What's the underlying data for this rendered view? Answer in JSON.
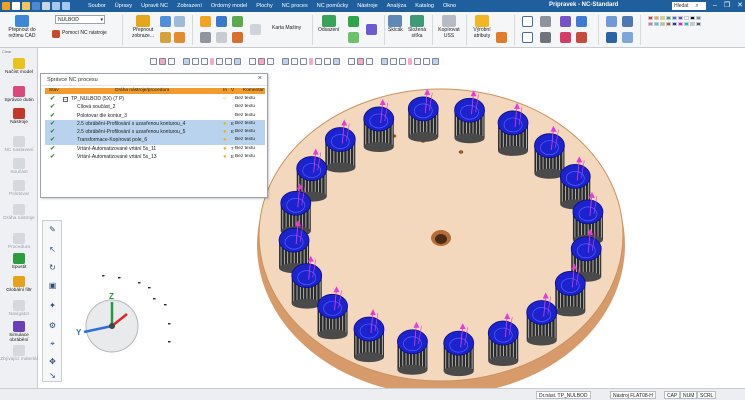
{
  "app": {
    "title": "Pripravek - NC-Standard",
    "menu": [
      "Soubor",
      "Úpravy",
      "Upravit NC",
      "Zobrazení",
      "Ordorný model",
      "Plochy",
      "NC proces",
      "NC pomůcky",
      "Nástroje",
      "Analýza",
      "Katalog",
      "Okno"
    ],
    "search_text": "Hledat"
  },
  "ribbon": {
    "combo_value": "NULBOD",
    "buttons": {
      "prepnout_cad": "Přepnout do režimu CAD",
      "pomoci_nc": "Pomocí NC nástroje",
      "prepnout_zobraz": "Přepnout zobraze...",
      "karta_masiny": "Karta Mašiny",
      "odsazeni": "Odsazení",
      "skicak": "Skicák",
      "slozena_sitka": "Složená síťka",
      "kopirovat_uss": "Kopírovat USS",
      "vyrobni_atributy": "Výrobní atributy"
    },
    "accent_colors": [
      "#d83b3b",
      "#2c7bd6",
      "#3da84b",
      "#f2b01e",
      "#8b3fd1",
      "#e06a1f"
    ]
  },
  "left_panel": {
    "label": "Clear",
    "items": [
      {
        "label": "Načíst model",
        "enabled": true,
        "color": "#e8c31e"
      },
      {
        "label": "Správce dutin",
        "enabled": true,
        "color": "#d94a7a"
      },
      {
        "label": "Nástroje",
        "enabled": true,
        "color": "#c0392b"
      },
      {
        "label": "NC nastavení",
        "enabled": false,
        "color": "#cccccc"
      },
      {
        "label": "Součást",
        "enabled": false,
        "color": "#cccccc"
      },
      {
        "label": "Polotovar",
        "enabled": false,
        "color": "#cccccc"
      },
      {
        "label": "Dráha nástroje",
        "enabled": false,
        "color": "#cccccc"
      },
      {
        "label": "Procedura",
        "enabled": false,
        "color": "#cccccc"
      },
      {
        "label": "Spustit",
        "enabled": true,
        "color": "#2c9c3c"
      },
      {
        "label": "Globální filtr",
        "enabled": true,
        "color": "#e6a21b"
      },
      {
        "label": "Navigátor",
        "enabled": false,
        "color": "#cccccc"
      },
      {
        "label": "Simulace obrábění",
        "enabled": true,
        "color": "#6a3fb8"
      },
      {
        "label": "Zbývající materiál",
        "enabled": false,
        "color": "#cccccc"
      }
    ]
  },
  "nc_dialog": {
    "title": "Správce NC procesu",
    "close_label": "×",
    "headers": {
      "stav": "Stav",
      "name": "Dráha nástroje/procedura",
      "in": "In",
      "v": "V",
      "komentar": "Komentář"
    },
    "rows": [
      {
        "name": "TP_NULBOD (5X) (7 P)",
        "comment": "Bez textu",
        "selected": false,
        "expand": "−",
        "bulb": "○",
        "v": ""
      },
      {
        "name": "Cílová součást_2",
        "comment": "Bez textu",
        "selected": false,
        "expand": "",
        "bulb": "",
        "v": ""
      },
      {
        "name": "Polotovar dle kontur_3",
        "comment": "Bez textu",
        "selected": false,
        "expand": "",
        "bulb": "",
        "v": ""
      },
      {
        "name": "2.5 obrábění-Profilování s uzavřenou konturou_4",
        "comment": "Bez textu",
        "selected": true,
        "expand": "",
        "bulb": "●",
        "v": "E"
      },
      {
        "name": "2.5 obrábění-Profilování s uzavřenou konturou_5",
        "comment": "Bez textu",
        "selected": true,
        "expand": "",
        "bulb": "●",
        "v": "E"
      },
      {
        "name": "Transformace-Kopírovat pole_6",
        "comment": "Bez textu",
        "selected": true,
        "expand": "",
        "bulb": "●",
        "v": ""
      },
      {
        "name": "Vrtání-Automatizované vrtání 5x_11",
        "comment": "Bez textu",
        "selected": false,
        "expand": "",
        "bulb": "●",
        "v": "7"
      },
      {
        "name": "Vrtání-Automatizované vrtání 5x_13",
        "comment": "Bez textu",
        "selected": false,
        "expand": "",
        "bulb": "●",
        "v": "E"
      }
    ]
  },
  "view": {
    "pocket_count": 20,
    "disc_color": "#f3d8bd",
    "disc_edge_color": "#d79b6b",
    "pocket_color": "#1d22cf",
    "toolpath_color": "#e63bd6",
    "triad_labels": {
      "x": "X",
      "y": "Y",
      "z": "Z"
    }
  },
  "status_bar": {
    "fields": [
      "Dr.nást.  TP_NULBOD",
      "Nástroj  FLAT08-H",
      "CAP",
      "NUM",
      "SCRL"
    ]
  }
}
